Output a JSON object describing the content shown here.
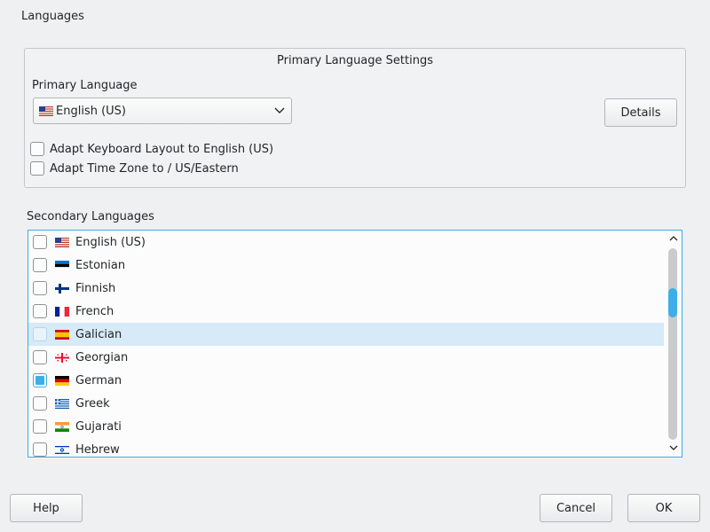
{
  "window": {
    "title": "Languages"
  },
  "primary": {
    "group_title": "Primary Language Settings",
    "label": "Primary Language",
    "selected": "English (US)",
    "selected_flag": "us-flag-icon",
    "details_label": "Details",
    "adapt_keyboard_label": "Adapt Keyboard Layout to English (US)",
    "adapt_keyboard_checked": false,
    "adapt_timezone_label": "Adapt Time Zone to  / US/Eastern",
    "adapt_timezone_checked": false
  },
  "secondary": {
    "label": "Secondary Languages",
    "items": [
      {
        "label": "English (US)",
        "flag": "us",
        "checked": false,
        "selected": false
      },
      {
        "label": "Estonian",
        "flag": "ee",
        "checked": false,
        "selected": false
      },
      {
        "label": "Finnish",
        "flag": "fi",
        "checked": false,
        "selected": false
      },
      {
        "label": "French",
        "flag": "fr",
        "checked": false,
        "selected": false
      },
      {
        "label": "Galician",
        "flag": "es",
        "checked": false,
        "selected": true
      },
      {
        "label": "Georgian",
        "flag": "ge",
        "checked": false,
        "selected": false
      },
      {
        "label": "German",
        "flag": "de",
        "checked": true,
        "selected": false
      },
      {
        "label": "Greek",
        "flag": "gr",
        "checked": false,
        "selected": false
      },
      {
        "label": "Gujarati",
        "flag": "in",
        "checked": false,
        "selected": false
      },
      {
        "label": "Hebrew",
        "flag": "il",
        "checked": false,
        "selected": false
      }
    ]
  },
  "buttons": {
    "help": "Help",
    "cancel": "Cancel",
    "ok": "OK"
  },
  "colors": {
    "accent": "#3daee9",
    "selection": "#d6eaf7",
    "background": "#eff0f1"
  }
}
